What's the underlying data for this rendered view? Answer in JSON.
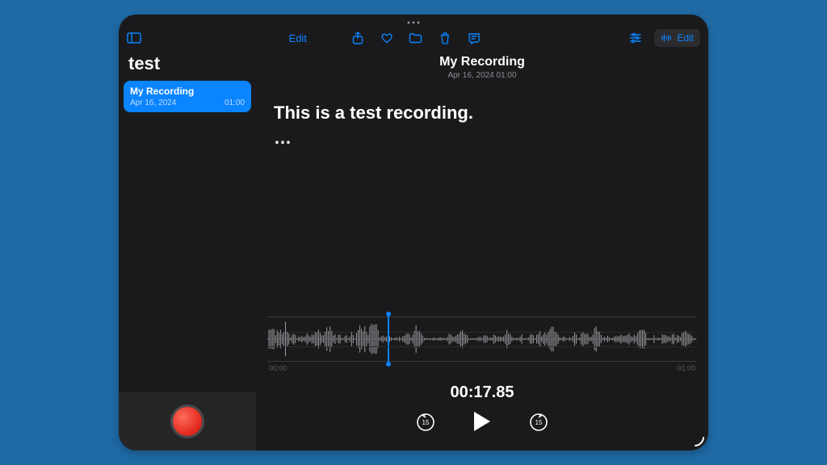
{
  "toolbar": {
    "edit_label": "Edit",
    "edit_pill_label": "Edit"
  },
  "sidebar": {
    "folder_title": "test",
    "items": [
      {
        "name": "My Recording",
        "date": "Apr 16, 2024",
        "duration": "01:00"
      }
    ]
  },
  "main": {
    "title": "My Recording",
    "subtitle": "Apr 16, 2024  01:00",
    "transcript_line": "This is a test recording.",
    "transcript_continuation": "…"
  },
  "playback": {
    "time_start": "00:00",
    "time_end": "01:00",
    "current_time": "00:17.85",
    "skip_seconds": "15"
  }
}
